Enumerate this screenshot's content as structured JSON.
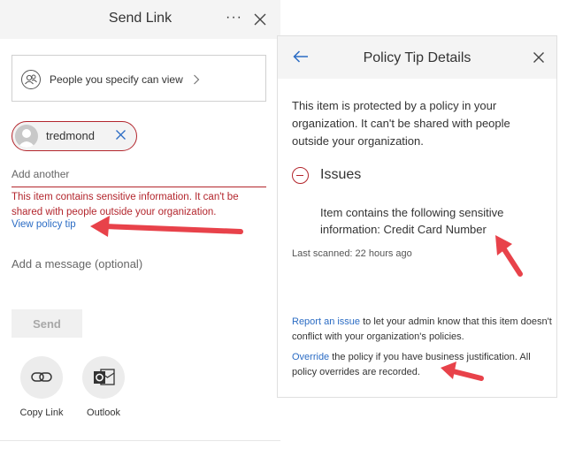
{
  "send_link": {
    "title": "Send Link",
    "more_label": "···",
    "permission_label": "People you specify can view",
    "recipient": {
      "name": "tredmond"
    },
    "add_another_placeholder": "Add another",
    "warning_text": "This item contains sensitive information. It can't be shared with people outside your organization.",
    "view_policy_tip": "View policy tip",
    "message_placeholder": "Add a message (optional)",
    "send_label": "Send",
    "share_options": [
      {
        "label": "Copy Link",
        "icon": "link-icon"
      },
      {
        "label": "Outlook",
        "icon": "outlook-icon"
      }
    ]
  },
  "policy_tip": {
    "title": "Policy Tip Details",
    "intro": "This item is protected by a policy in your organization. It can't be shared with people outside your organization.",
    "issues_title": "Issues",
    "issue_text": "Item contains the following sensitive information: Credit Card Number",
    "last_scanned": "Last scanned: 22 hours ago",
    "report_link": "Report an issue",
    "report_rest": " to let your admin know that this item doesn't conflict with your organization's policies.",
    "override_link": "Override",
    "override_rest": " the policy if you have business justification. All policy overrides are recorded."
  },
  "colors": {
    "error_red": "#b3262d",
    "link_blue": "#2b6cc4",
    "annotation_arrow": "#e8424a"
  }
}
